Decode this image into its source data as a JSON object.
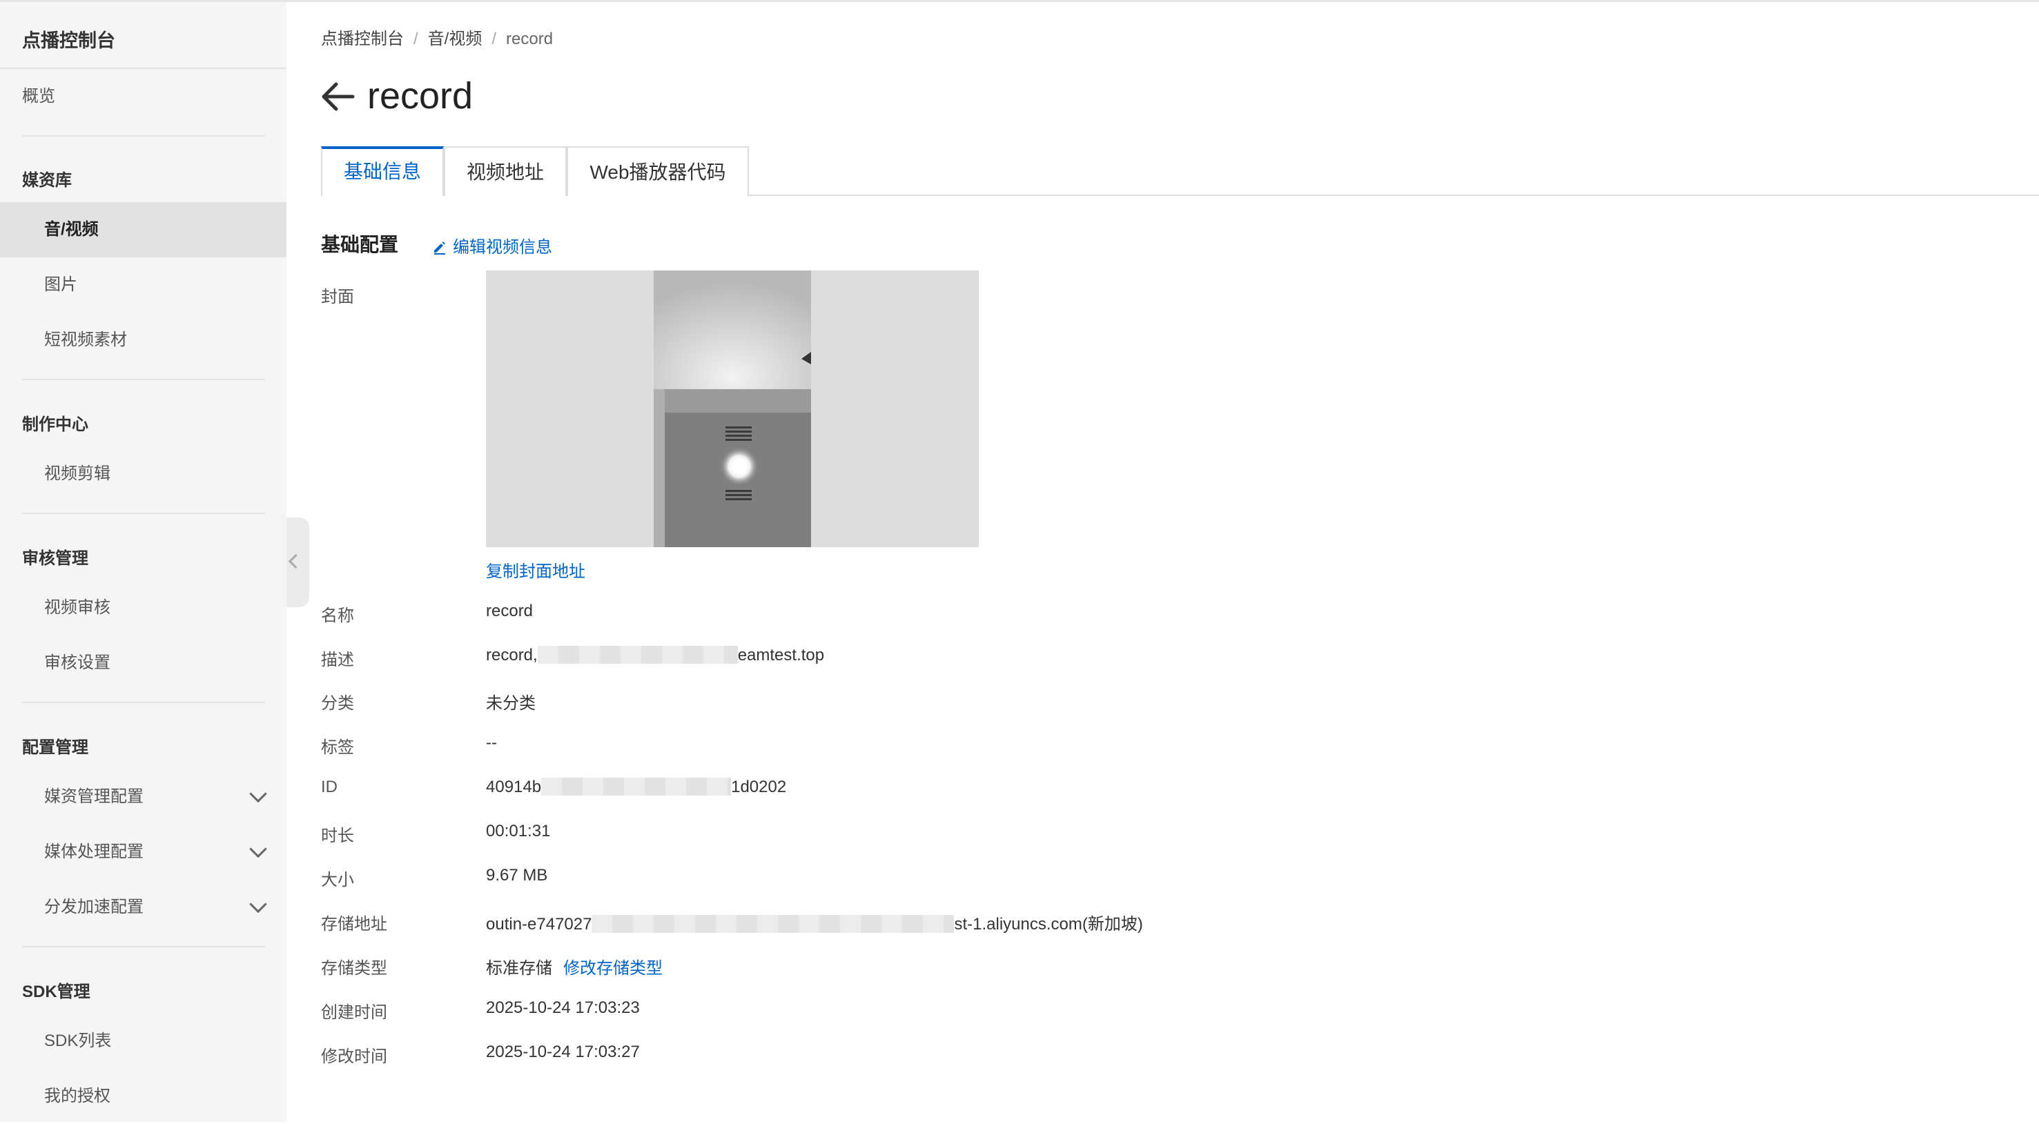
{
  "sidebar": {
    "title": "点播控制台",
    "overview": "概览",
    "sections": {
      "media": {
        "heading": "媒资库",
        "items": [
          "音/视频",
          "图片",
          "短视频素材"
        ]
      },
      "production": {
        "heading": "制作中心",
        "items": [
          "视频剪辑"
        ]
      },
      "review": {
        "heading": "审核管理",
        "items": [
          "视频审核",
          "审核设置"
        ]
      },
      "config": {
        "heading": "配置管理",
        "items": [
          "媒资管理配置",
          "媒体处理配置",
          "分发加速配置"
        ]
      },
      "sdk": {
        "heading": "SDK管理",
        "items": [
          "SDK列表",
          "我的授权"
        ]
      }
    },
    "active_item": "音/视频"
  },
  "breadcrumb": {
    "items": [
      "点播控制台",
      "音/视频",
      "record"
    ],
    "separator": "/"
  },
  "page": {
    "title": "record"
  },
  "tabs": [
    {
      "label": "基础信息",
      "active": true
    },
    {
      "label": "视频地址",
      "active": false
    },
    {
      "label": "Web播放器代码",
      "active": false
    }
  ],
  "section": {
    "title": "基础配置",
    "edit_label": "编辑视频信息"
  },
  "cover": {
    "label": "封面",
    "copy_link": "复制封面地址"
  },
  "fields": {
    "name": {
      "label": "名称",
      "value": "record"
    },
    "description": {
      "label": "描述",
      "prefix": "record,",
      "suffix": "eamtest.top"
    },
    "category": {
      "label": "分类",
      "value": "未分类"
    },
    "tags": {
      "label": "标签",
      "value": "--"
    },
    "id": {
      "label": "ID",
      "prefix": "40914b",
      "suffix": "1d0202"
    },
    "duration": {
      "label": "时长",
      "value": "00:01:31"
    },
    "size": {
      "label": "大小",
      "value": "9.67 MB"
    },
    "storage_address": {
      "label": "存储地址",
      "prefix": "outin-e747027",
      "suffix": "st-1.aliyuncs.com(新加坡)"
    },
    "storage_type": {
      "label": "存储类型",
      "value": "标准存储",
      "action": "修改存储类型"
    },
    "created": {
      "label": "创建时间",
      "value": "2025-10-24 17:03:23"
    },
    "modified": {
      "label": "修改时间",
      "value": "2025-10-24 17:03:27"
    }
  },
  "colors": {
    "accent": "#0064c8",
    "sidebar_bg": "#f5f5f5",
    "active_bg": "#e2e2e2"
  },
  "icons": {
    "back": "arrow-left-icon",
    "edit": "pencil-icon",
    "collapse": "chevron-left-icon",
    "expand": "chevron-down-icon"
  }
}
